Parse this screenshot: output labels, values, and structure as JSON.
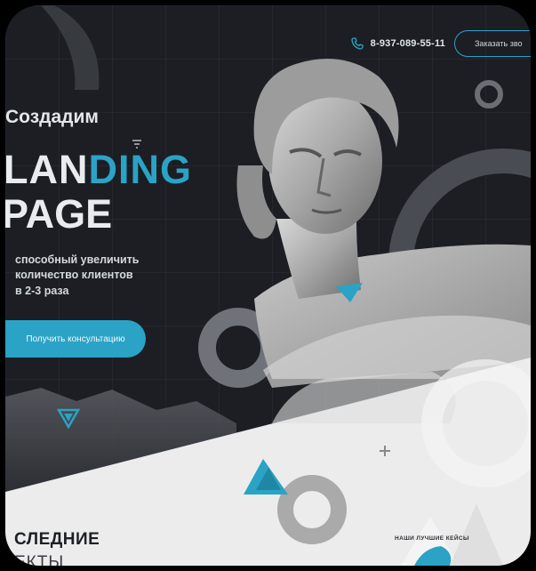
{
  "header": {
    "phone": "8-937-089-55-11",
    "order_button": "Заказать зво"
  },
  "hero": {
    "kicker": "Создадим",
    "title_part1": "LAN",
    "title_part2": "DING",
    "title_line2": "PAGE",
    "subtitle": [
      "способный увеличить",
      "количество клиентов",
      "в 2-3 раза"
    ],
    "cta_label": "Получить консультацию"
  },
  "bottom": {
    "heading_line1": "СЛЕДНИЕ",
    "heading_line2": "ЕКТЫ",
    "cases_label": "НАШИ ЛУЧШИЕ КЕЙСЫ"
  },
  "colors": {
    "accent": "#2aa3c6",
    "dark": "#1c1e24",
    "light": "#ececec"
  },
  "icons": {
    "phone": "phone-icon",
    "down": "triangle-down-icon",
    "plus": "plus-icon"
  }
}
